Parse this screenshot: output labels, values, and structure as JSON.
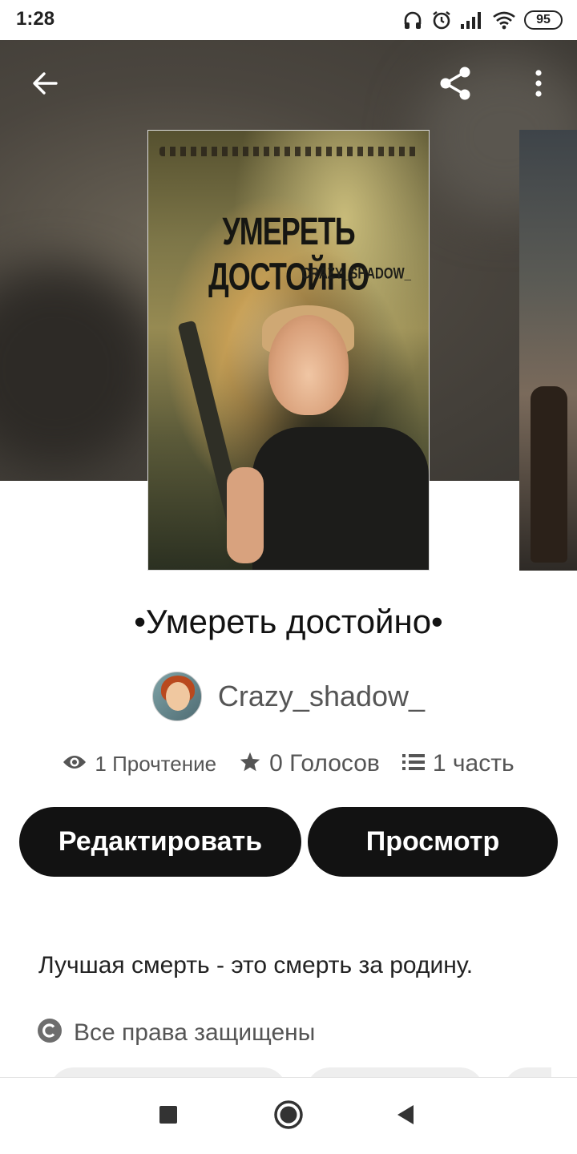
{
  "status_bar": {
    "time": "1:28",
    "battery_level": "95",
    "icons": [
      "headphones-icon",
      "alarm-icon",
      "signal-icon",
      "wifi-icon",
      "battery-icon"
    ]
  },
  "top_bar": {
    "icons": [
      "back-arrow-icon",
      "share-icon",
      "more-vertical-icon"
    ]
  },
  "cover": {
    "title": "УМЕРЕТЬ ДОСТОЙНО",
    "author": "CRAZY_SHADOW_"
  },
  "story": {
    "title": "•Умереть достойно•",
    "author": "Crazy_shadow_",
    "stats": {
      "reads": "1 Прочтение",
      "votes": "0 Голосов",
      "parts": "1 часть"
    },
    "description": "Лучшая смерть - это смерть за родину.",
    "rights": "Все права защищены"
  },
  "actions": {
    "edit_label": "Редактировать",
    "view_label": "Просмотр"
  },
  "nav": {
    "icons": [
      "recent-apps-icon",
      "home-icon",
      "back-triangle-icon"
    ]
  },
  "colors": {
    "button_bg": "#121212",
    "button_text": "#ffffff",
    "secondary_text": "#555555"
  }
}
